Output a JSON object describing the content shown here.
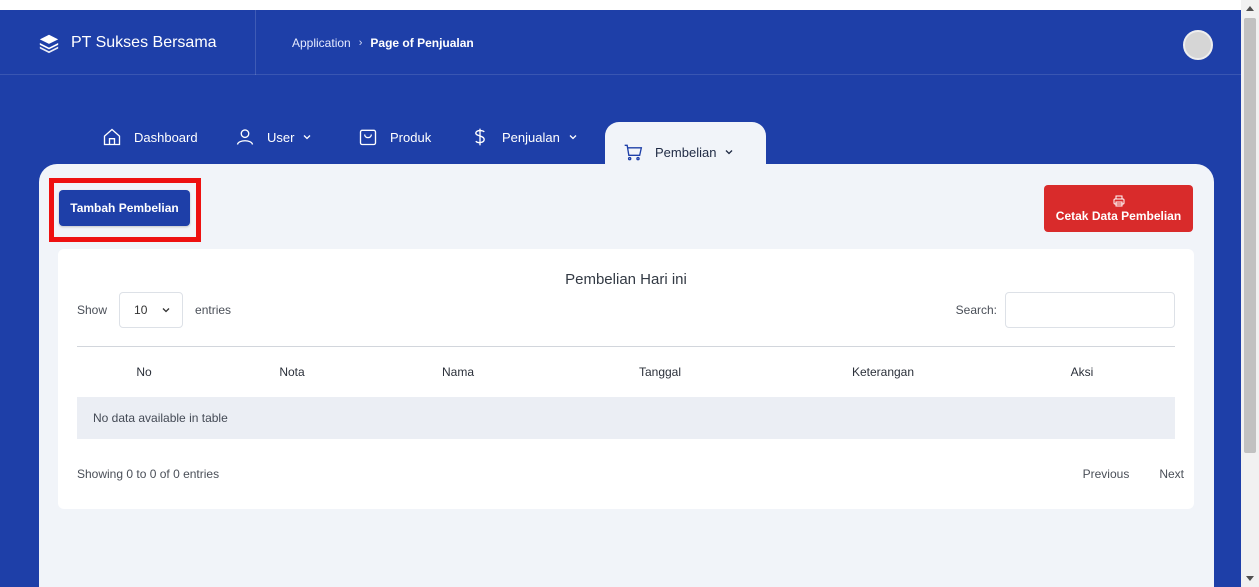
{
  "app": {
    "brand": "PT Sukses Bersama",
    "accent": "#1e3fa8",
    "danger": "#d92b2b"
  },
  "breadcrumb": {
    "root": "Application",
    "current": "Page of Penjualan"
  },
  "nav": [
    {
      "label": "Dashboard",
      "icon": "home-icon",
      "dropdown": false
    },
    {
      "label": "User",
      "icon": "user-icon",
      "dropdown": true
    },
    {
      "label": "Produk",
      "icon": "shopping-bag-icon",
      "dropdown": false
    },
    {
      "label": "Penjualan",
      "icon": "dollar-icon",
      "dropdown": true
    },
    {
      "label": "Pembelian",
      "icon": "cart-icon",
      "dropdown": true,
      "active": true
    }
  ],
  "actions": {
    "add": "Tambah Pembelian",
    "print": "Cetak Data Pembelian"
  },
  "table": {
    "title": "Pembelian Hari ini",
    "show_label": "Show",
    "entries_value": "10",
    "entries_label": "entries",
    "search_label": "Search:",
    "columns": [
      "No",
      "Nota",
      "Nama",
      "Tanggal",
      "Keterangan",
      "Aksi"
    ],
    "empty": "No data available in table",
    "info": "Showing 0 to 0 of 0 entries",
    "prev": "Previous",
    "next": "Next"
  }
}
